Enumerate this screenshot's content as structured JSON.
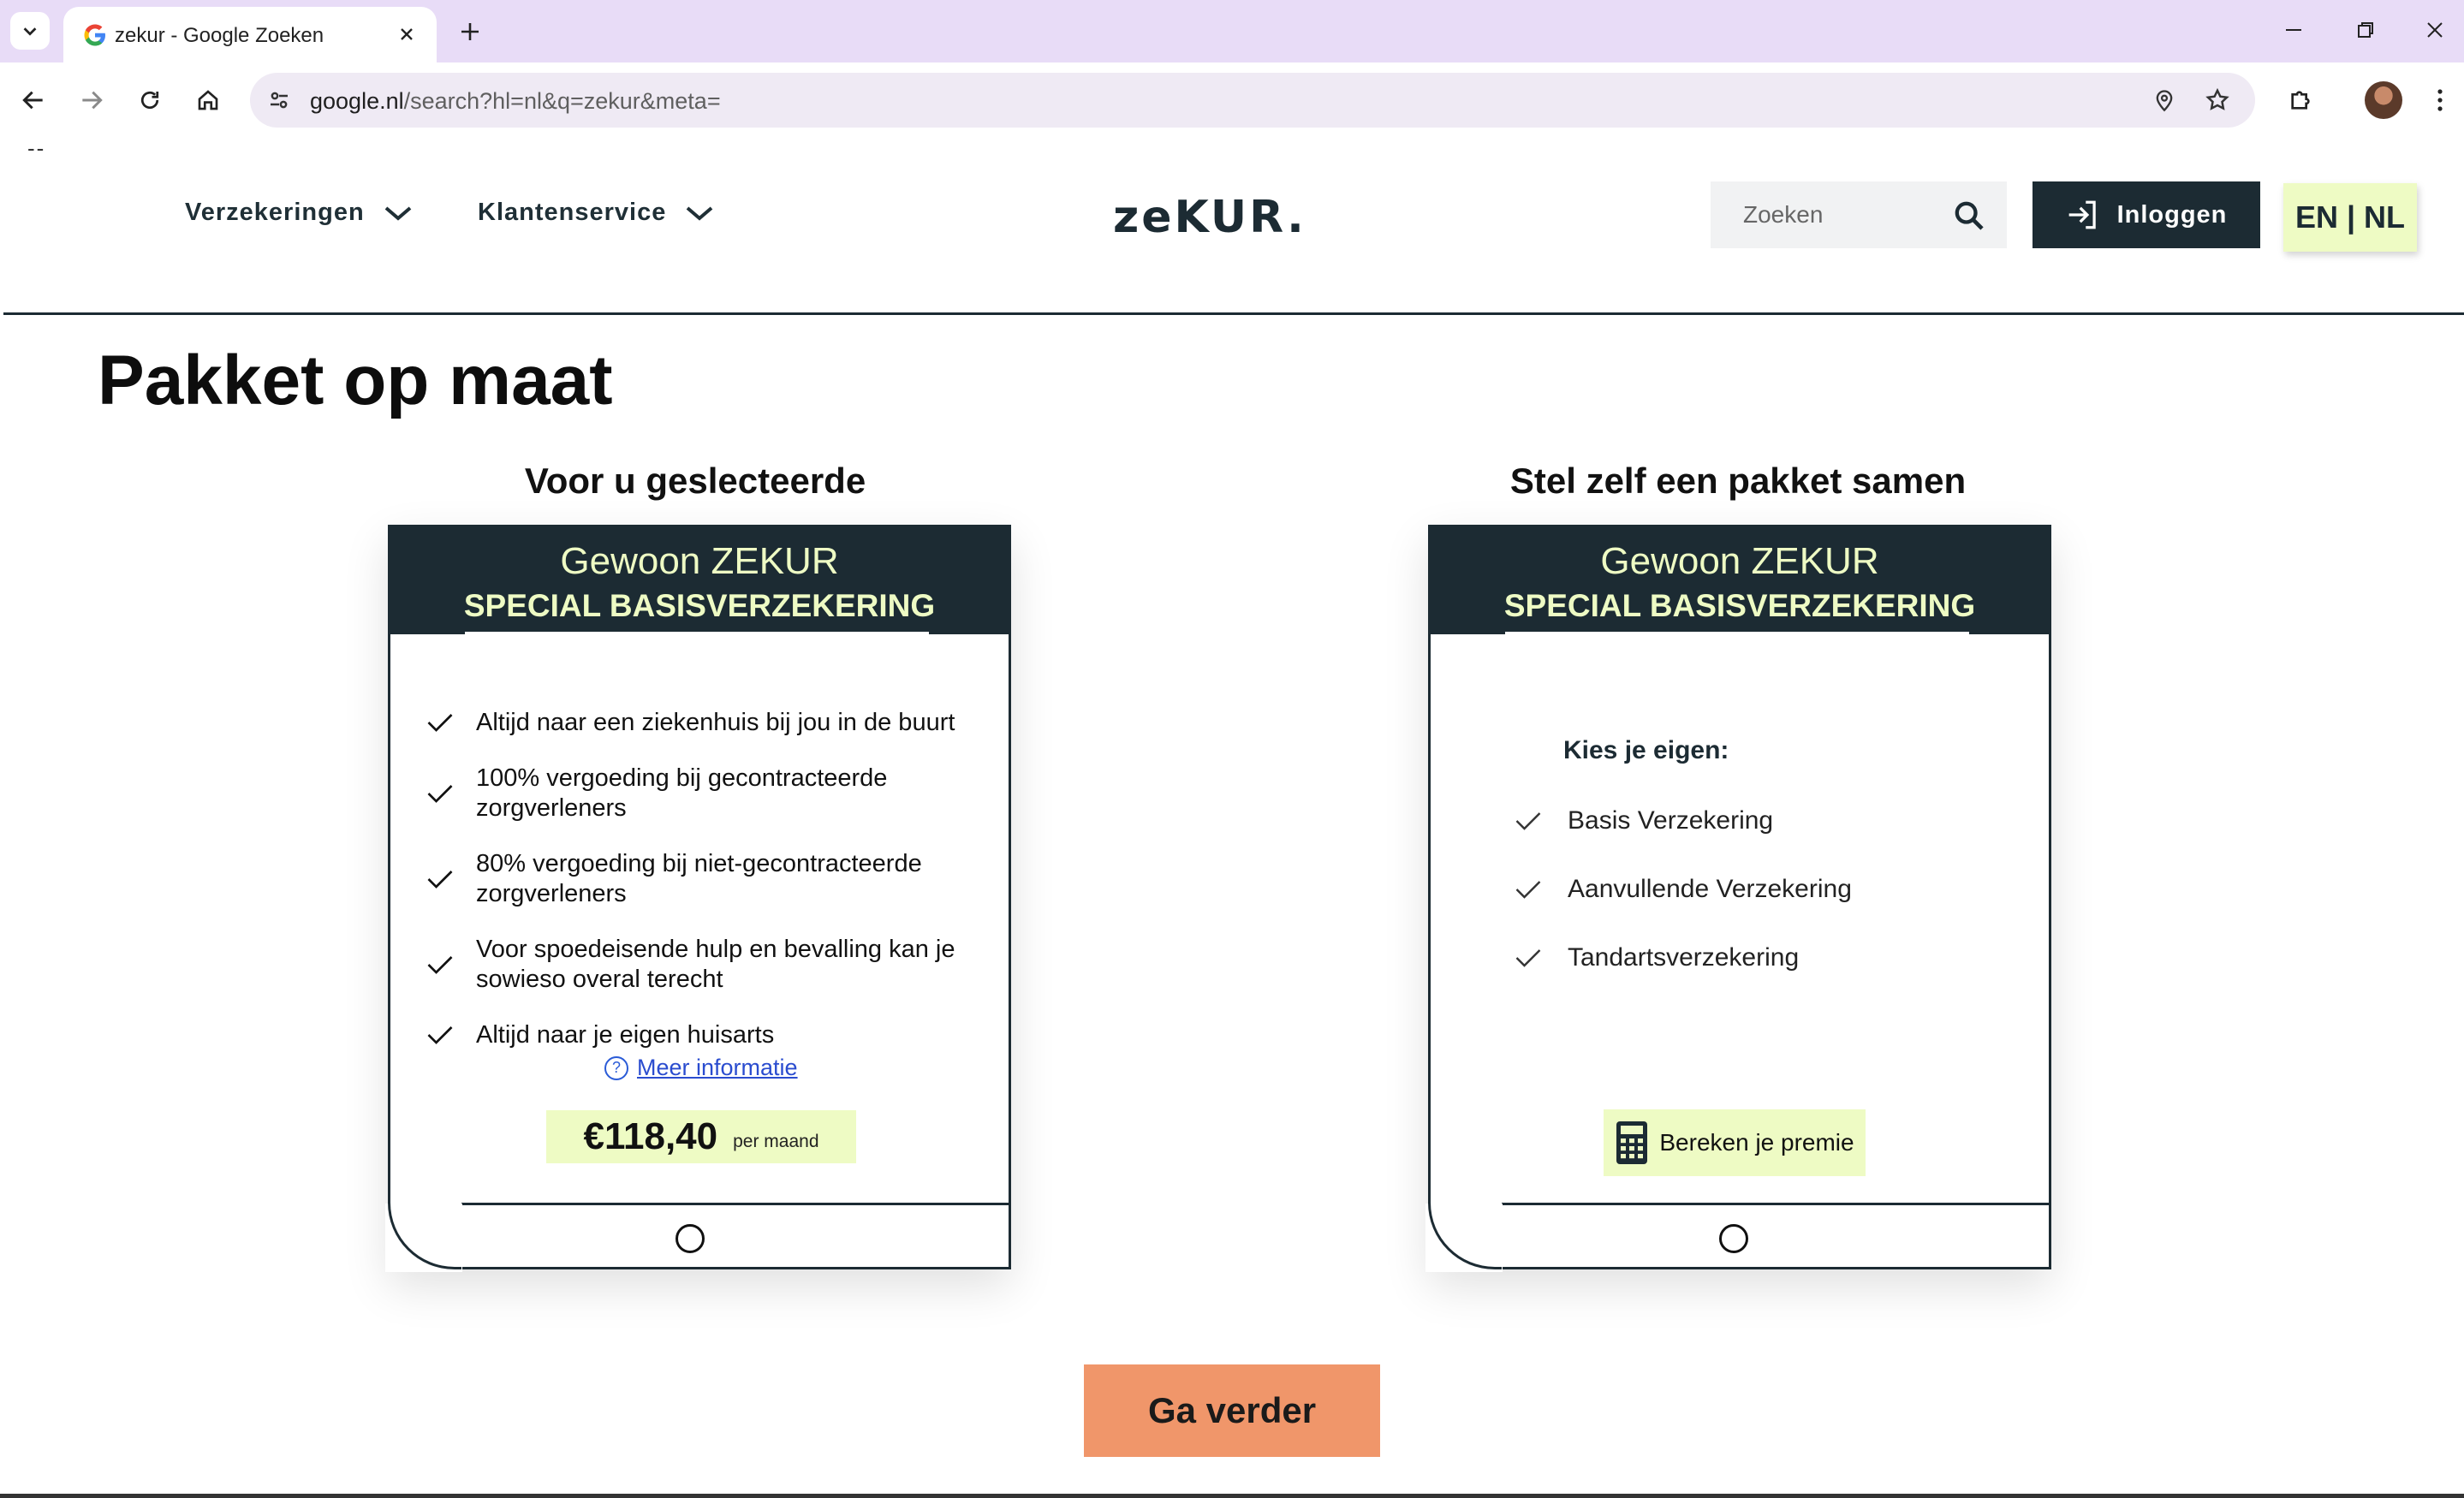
{
  "browser": {
    "tab_title": "zekur - Google Zoeken",
    "url_host": "google.nl",
    "url_path": "/search?hl=nl&q=zekur&meta=",
    "dashes": "--"
  },
  "site": {
    "logo": "zeKUR.",
    "nav": [
      {
        "label": "Verzekeringen"
      },
      {
        "label": "Klantenservice"
      }
    ],
    "search": {
      "placeholder": "Zoeken"
    },
    "login_label": "Inloggen",
    "lang_label": "EN | NL"
  },
  "main": {
    "page_title": "Pakket op maat",
    "left": {
      "column_title": "Voor u geslecteerde",
      "card_title": "Gewoon ZEKUR",
      "card_subtitle": "SPECIAL BASISVERZEKERING",
      "features": [
        "Altijd naar een ziekenhuis bij jou in de buurt",
        "100% vergoeding bij gecontracteerde zorgverleners",
        "80% vergoeding bij niet-gecontracteerde zorgverleners",
        "Voor spoedeisende hulp en bevalling kan je sowieso overal terecht",
        "Altijd naar je eigen huisarts"
      ],
      "more_info": "Meer informatie",
      "more_info_icon": "?",
      "price": "€118,40",
      "price_period": "per maand"
    },
    "right": {
      "column_title": "Stel zelf een pakket samen",
      "card_title": "Gewoon ZEKUR",
      "card_subtitle": "SPECIAL BASISVERZEKERING",
      "choose_label": "Kies je eigen:",
      "options": [
        "Basis Verzekering",
        "Aanvullende Verzekering",
        "Tandartsverzekering"
      ],
      "calc_label": "Bereken je premie"
    },
    "cta_label": "Ga verder"
  },
  "colors": {
    "dark": "#1c2b33",
    "lime": "#eefbc4",
    "cta": "#f0966a",
    "browser_frame": "#e8dcf7"
  }
}
